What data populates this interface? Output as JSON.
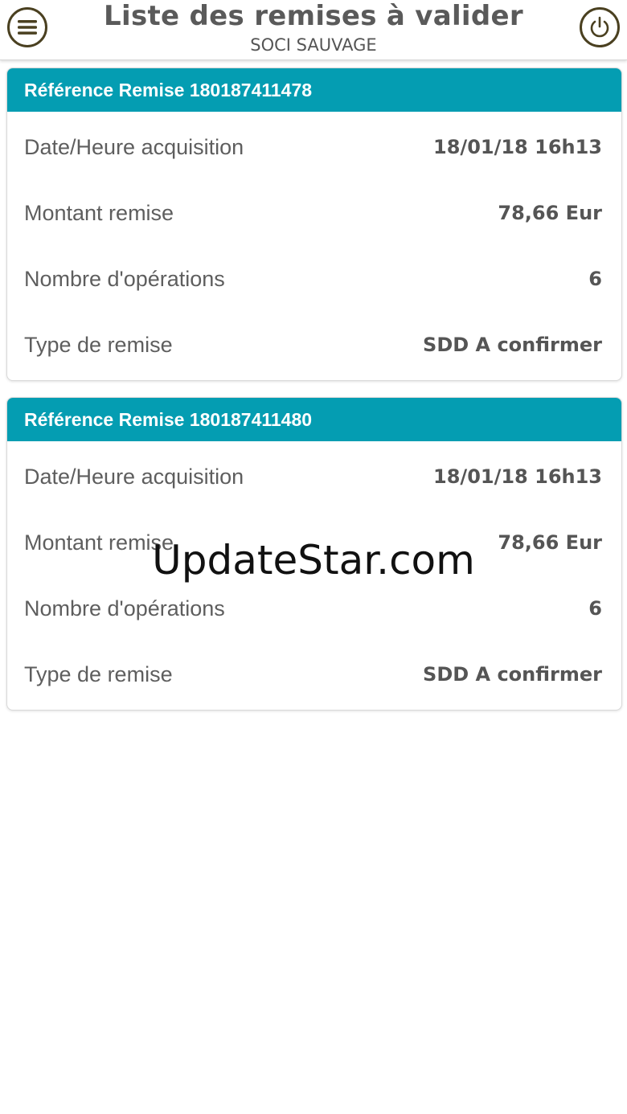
{
  "header": {
    "title": "Liste des remises à valider",
    "subtitle": "SOCI SAUVAGE",
    "menu_icon": "menu-icon",
    "power_icon": "power-icon"
  },
  "remises": [
    {
      "header": "Référence Remise 180187411478",
      "rows": [
        {
          "label": "Date/Heure acquisition",
          "value": "18/01/18 16h13"
        },
        {
          "label": "Montant remise",
          "value": "78,66 Eur"
        },
        {
          "label": "Nombre d'opérations",
          "value": "6"
        },
        {
          "label": "Type de remise",
          "value": "SDD A confirmer"
        }
      ]
    },
    {
      "header": "Référence Remise 180187411480",
      "rows": [
        {
          "label": "Date/Heure acquisition",
          "value": "18/01/18 16h13"
        },
        {
          "label": "Montant remise",
          "value": "78,66 Eur"
        },
        {
          "label": "Nombre d'opérations",
          "value": "6"
        },
        {
          "label": "Type de remise",
          "value": "SDD A confirmer"
        }
      ]
    }
  ],
  "watermark": "UpdateStar.com",
  "colors": {
    "accent": "#049db2",
    "icon": "#4a4020"
  }
}
